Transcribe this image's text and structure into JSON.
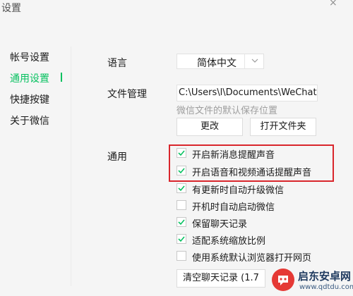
{
  "window": {
    "title": "设置",
    "close_glyph": "×"
  },
  "sidebar": {
    "items": [
      {
        "label": "帐号设置",
        "active": false
      },
      {
        "label": "通用设置",
        "active": true
      },
      {
        "label": "快捷按键",
        "active": false
      },
      {
        "label": "关于微信",
        "active": false
      }
    ]
  },
  "main": {
    "language": {
      "label": "语言",
      "selected": "简体中文"
    },
    "files": {
      "label": "文件管理",
      "path": "C:\\Users\\l\\Documents\\WeChat Files",
      "hint": "微信文件的默认保存位置",
      "change_button": "更改",
      "open_button": "打开文件夹"
    },
    "general": {
      "label": "通用",
      "options": [
        {
          "label": "开启新消息提醒声音",
          "checked": true
        },
        {
          "label": "开启语音和视频通话提醒声音",
          "checked": true
        },
        {
          "label": "有更新时自动升级微信",
          "checked": true
        },
        {
          "label": "开机时自动启动微信",
          "checked": false
        },
        {
          "label": "保留聊天记录",
          "checked": true
        },
        {
          "label": "适配系统缩放比例",
          "checked": true
        },
        {
          "label": "使用系统默认浏览器打开网页",
          "checked": false
        }
      ],
      "clear_button": "清空聊天记录 (1.7"
    }
  },
  "watermark": {
    "title": "启东安卓网",
    "url": "www.qdtdu.com"
  },
  "colors": {
    "accent": "#07c160",
    "highlight": "#d9262c",
    "background": "#f5f5f5"
  }
}
